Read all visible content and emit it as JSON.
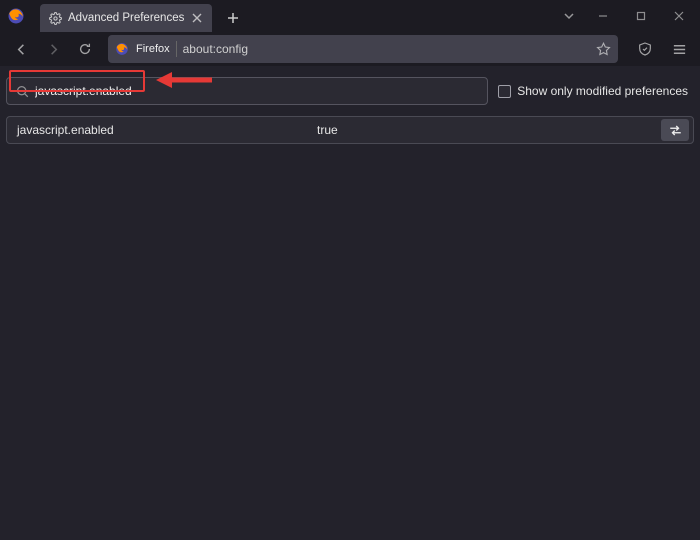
{
  "tab": {
    "title": "Advanced Preferences"
  },
  "urlbar": {
    "badge": "Firefox",
    "url": "about:config"
  },
  "search": {
    "value": "javascript.enabled",
    "show_only_modified_label": "Show only modified preferences"
  },
  "result": {
    "name": "javascript.enabled",
    "value": "true"
  }
}
